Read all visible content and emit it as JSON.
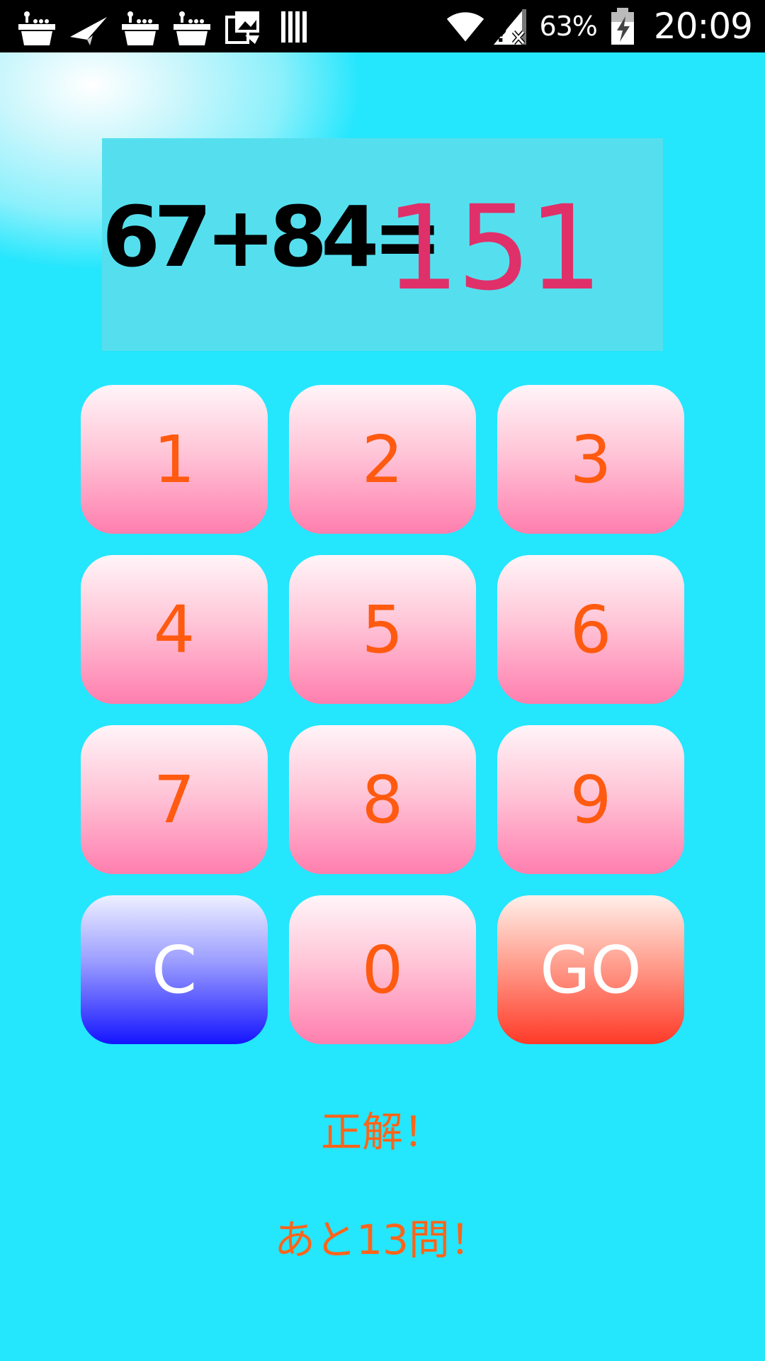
{
  "status_bar": {
    "left_icons": [
      "basket-icon",
      "paper-plane-icon",
      "basket-icon",
      "basket-icon",
      "photos-icon",
      "barcode-icon"
    ],
    "right_icons": [
      "wifi-icon",
      "no-sim-icon",
      "battery-icon"
    ],
    "battery": "63%",
    "time": "20:09"
  },
  "display": {
    "question": "67+84=",
    "answer": "151"
  },
  "keypad": {
    "keys": [
      "1",
      "2",
      "3",
      "4",
      "5",
      "6",
      "7",
      "8",
      "9",
      "C",
      "0",
      "GO"
    ]
  },
  "messages": {
    "result": "正解！",
    "remaining": "あと13問！"
  },
  "colors": {
    "background": "#24e6fd",
    "display_box": "#55dfee",
    "answer_text": "#e0306a",
    "key_text": "#ff5a10",
    "clear_key": "#1414ff",
    "go_key": "#ff3a28",
    "message_text": "#ff6418"
  }
}
